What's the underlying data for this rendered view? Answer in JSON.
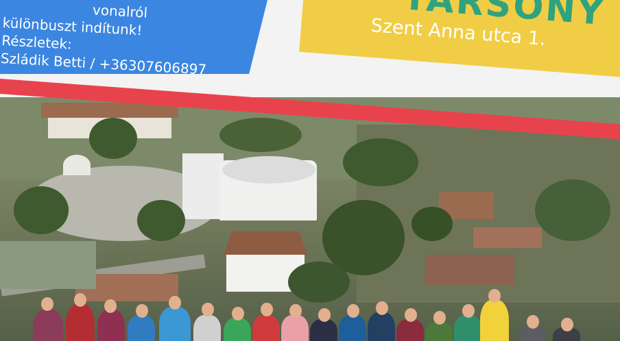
{
  "blue_panel": {
    "line1": "vonalról",
    "line2": "különbuszt indítunk!",
    "line3": "Részletek:",
    "line4": "Szládik Betti / +36307606897"
  },
  "yellow_panel": {
    "title": "TARSONY",
    "address": "Szent Anna utca 1."
  },
  "colors": {
    "blue": "#3b86e0",
    "yellow": "#f1cd45",
    "green_title": "#2fa37e",
    "red_stripe": "#e8434d"
  },
  "photo": {
    "description_icon": "aerial-village-church-photo"
  }
}
